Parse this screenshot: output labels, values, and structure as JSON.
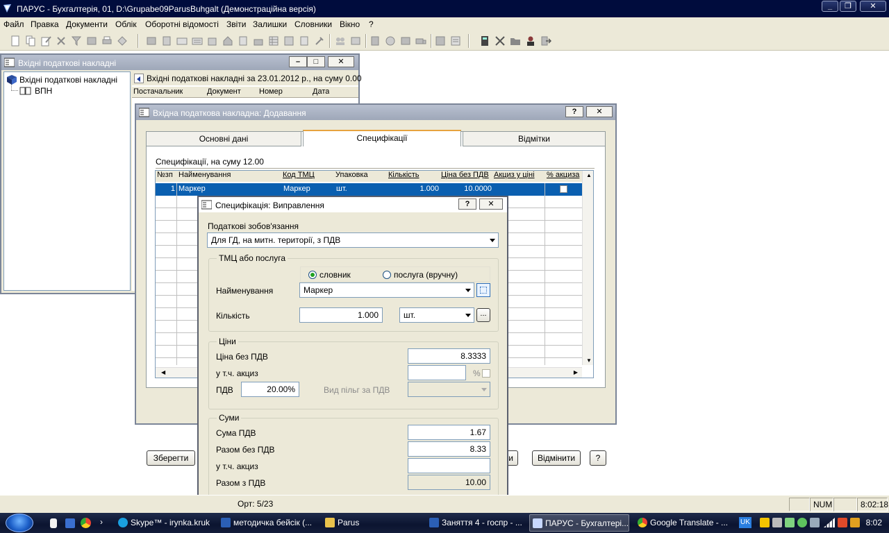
{
  "app": {
    "title": "ПАРУС - Бухгалтерія, 01, D:\\Grupabe09ParusBuhgalt (Демонстраційна версія)",
    "minimize": "_",
    "restore": "❐",
    "close": "✕"
  },
  "menu": [
    "Файл",
    "Правка",
    "Документи",
    "Облік",
    "Оборотні відомості",
    "Звіти",
    "Залишки",
    "Словники",
    "Вікно",
    "?"
  ],
  "window_invoices": {
    "title": "Вхідні податкові накладні",
    "tree_root": "Вхідні податкові накладні",
    "tree_child": "ВПН",
    "header": "Вхідні податкові накладні за 23.01.2012 р., на суму 0.00",
    "columns": [
      "Постачальник",
      "Документ",
      "Номер",
      "Дата"
    ]
  },
  "window_invoice_add": {
    "title": "Вхідна податкова накладна: Додавання",
    "tabs": [
      "Основні дані",
      "Специфікації",
      "Відмітки"
    ],
    "spec_header": "Специфікації, на суму 12.00",
    "columns": [
      "№зп",
      "Найменування",
      "Код ТМЦ",
      "Упаковка",
      "Кількість",
      "Ціна без ПДВ",
      "Акциз у ціні",
      "% акциза"
    ],
    "row": {
      "num": "1",
      "name": "Маркер",
      "code": "Маркер",
      "pack": "шт.",
      "qty": "1.000",
      "price": "10.0000"
    },
    "save_button": "Зберегти",
    "hidden_button_tail": "ти",
    "cancel_button": "Відмінити",
    "help_button": "?"
  },
  "window_spec_edit": {
    "title": "Специфікація: Виправлення",
    "help": "?",
    "close": "✕",
    "tax_label": "Податкові зобов'язання",
    "tax_value": "Для ГД, на митн. території, з ПДВ",
    "goods_group": "ТМЦ або послуга",
    "radio_dict": "словник",
    "radio_service": "послуга (вручну)",
    "name_label": "Найменування",
    "name_value": "Маркер",
    "qty_label": "Кількість",
    "qty_value": "1.000",
    "unit_value": "шт.",
    "ellipsis": "...",
    "prices_group": "Ціни",
    "price_label": "Ціна без ПДВ",
    "price_value": "8.3333",
    "excise_label": "у т.ч. акциз",
    "excise_value": "",
    "percent_sign": "%",
    "vat_label": "ПДВ",
    "vat_value": "20.00%",
    "benefit_label": "Вид пільг за ПДВ",
    "sums_group": "Суми",
    "vat_sum_label": "Сума ПДВ",
    "vat_sum_value": "1.67",
    "total_novat_label": "Разом без ПДВ",
    "total_novat_value": "8.33",
    "excise_sum_label": "у т.ч. акциз",
    "excise_sum_value": "",
    "total_vat_label": "Разом з ПДВ",
    "total_vat_value": "10.00"
  },
  "status": {
    "record": "Орт: 5/23",
    "num": "NUM",
    "time": "8:02:18"
  },
  "taskbar": {
    "tasks": [
      "Skype™ - irynka.kruk",
      "методичка бейсік (...",
      "Parus",
      "Заняття 4 - госпр - ...",
      "ПАРУС - Бухгалтері...",
      "Google Translate - ..."
    ],
    "lang": "UK",
    "clock": "8:02"
  },
  "colors": {
    "selection": "#0a5fb0",
    "title_dark": "#000c3d",
    "face": "#ece9d8"
  }
}
